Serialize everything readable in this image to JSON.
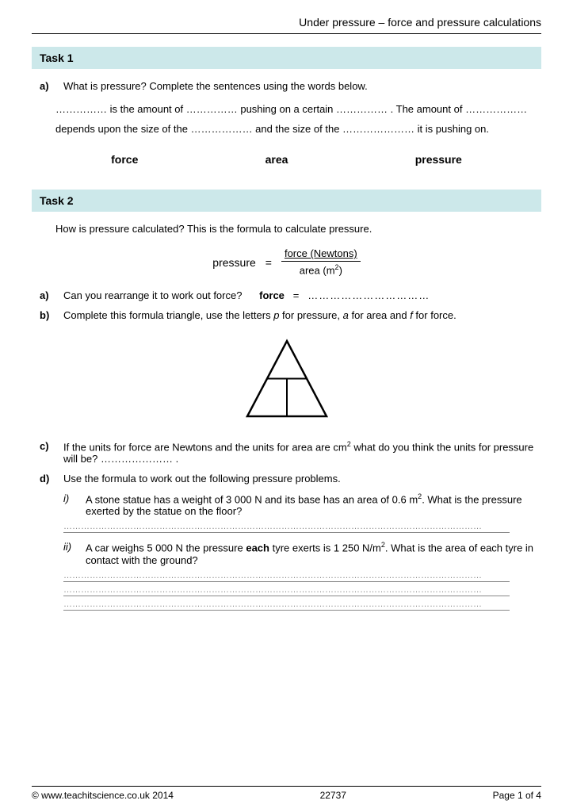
{
  "page": {
    "title": "Under pressure – force and pressure calculations",
    "footer": {
      "copyright": "© www.teachitscience.co.uk 2014",
      "code": "22737",
      "page": "Page 1 of 4"
    }
  },
  "task1": {
    "header": "Task 1",
    "question_a_label": "a)",
    "question_a_text": "What is pressure?  Complete the sentences using the words below.",
    "fill_sentence": "…………… is the amount of ……………  pushing on a certain …………… . The amount of ……………… depends upon the size of the ………………  and the size of the ………………… it is pushing on.",
    "words": [
      "force",
      "area",
      "pressure"
    ]
  },
  "task2": {
    "header": "Task 2",
    "intro": "How is pressure calculated?  This is the formula to calculate pressure.",
    "formula_label": "pressure",
    "formula_equals": "=",
    "formula_numerator": "force (Newtons)",
    "formula_denominator": "area (m²)",
    "qa_label": "a)",
    "qa_text": "Can you rearrange it to work out force?",
    "qa_force": "force",
    "qa_equals": "=",
    "qa_dots": "……………………………",
    "qb_label": "b)",
    "qb_text": "Complete this formula triangle, use the letters p for pressure, a for area and f for force.",
    "qc_label": "c)",
    "qc_text": "If the units for force are Newtons and the units for area are cm² what do you think the units for pressure will be?  ………………… .",
    "qd_label": "d)",
    "qd_text": "Use the formula to work out the following pressure problems.",
    "sub_i_label": "i)",
    "sub_i_text": "A stone statue has a weight of 3 000 N and its base has an area of 0.6 m².  What is the pressure exerted by the statue on the floor?",
    "sub_ii_label": "ii)",
    "sub_ii_text": "A car weighs 5 000 N the pressure each tyre exerts is 1 250 N/m². What is the area of each tyre in contact with the ground?",
    "answer_dots": "………………………………………………………………………………………………………………"
  }
}
